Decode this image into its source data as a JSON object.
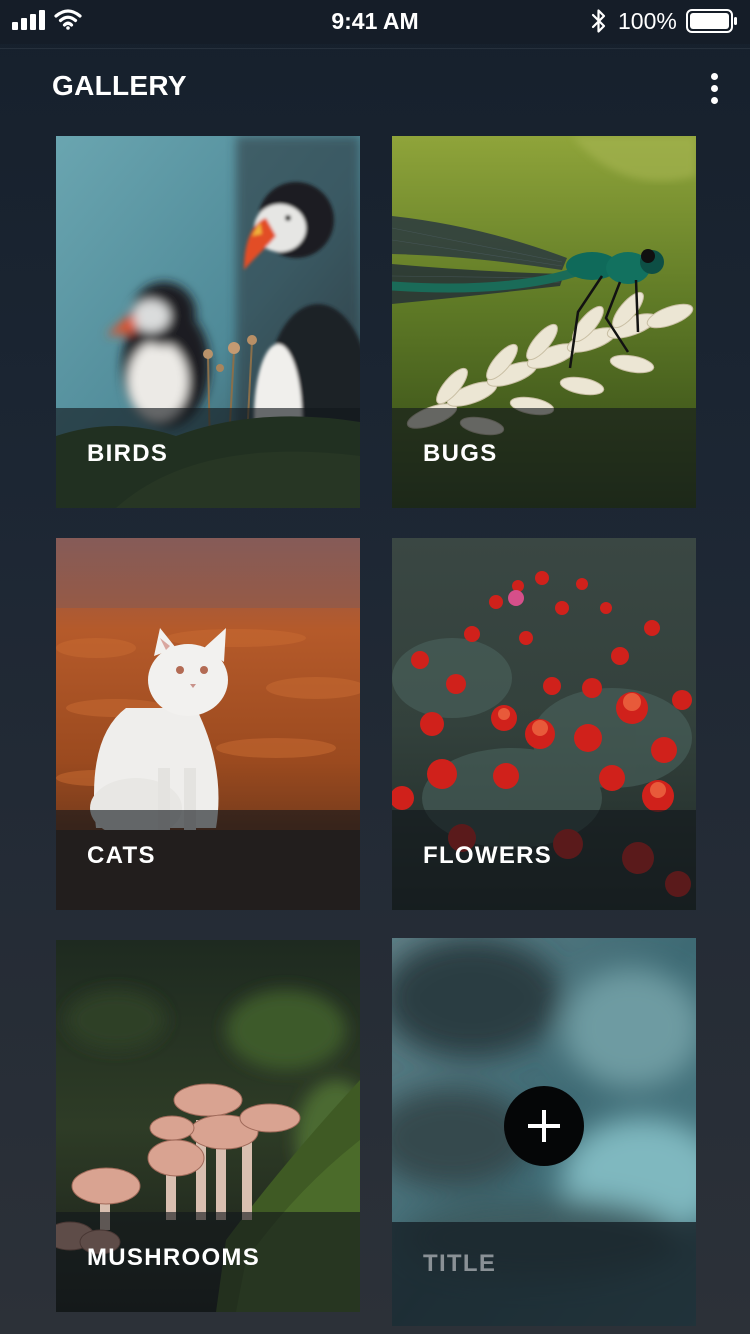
{
  "status_bar": {
    "time": "9:41 AM",
    "battery_percent": "100%",
    "icons": [
      "signal-icon",
      "wifi-icon",
      "bluetooth-icon",
      "battery-icon"
    ]
  },
  "header": {
    "title": "GALLERY",
    "menu_icon": "more-vertical-icon"
  },
  "tiles": [
    {
      "label": "BIRDS"
    },
    {
      "label": "BUGS"
    },
    {
      "label": "CATS"
    },
    {
      "label": "FLOWERS"
    },
    {
      "label": "MUSHROOMS"
    },
    {
      "label": "TITLE",
      "action_icon": "plus-icon"
    }
  ],
  "colors": {
    "background_top": "#16202c",
    "background_bottom": "#2c3138",
    "add_button": "#050607",
    "placeholder_caption": "#8a9196"
  }
}
